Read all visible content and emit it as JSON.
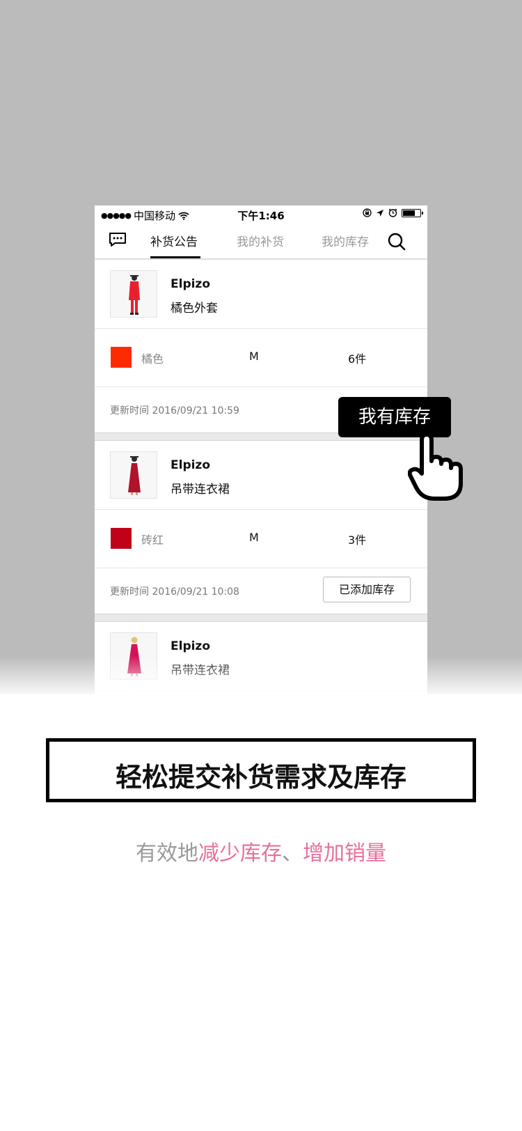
{
  "status_bar": {
    "carrier": "中国移动",
    "time": "下午1:46",
    "battery_level": 0.7
  },
  "nav": {
    "tabs": [
      "补货公告",
      "我的补货",
      "我的库存"
    ],
    "active_tab": 0,
    "icons": [
      "chat-icon",
      "search-icon"
    ]
  },
  "items": [
    {
      "brand": "Elpizo",
      "name": "橘色外套",
      "color_name": "橘色",
      "color_hex": "#ff2b00",
      "size": "M",
      "quantity": "6件",
      "updated": "更新时间 2016/09/21 10:59",
      "garment_color": "#e8202e"
    },
    {
      "brand": "Elpizo",
      "name": "吊带连衣裙",
      "color_name": "砖红",
      "color_hex": "#c00018",
      "size": "M",
      "quantity": "3件",
      "updated": "更新时间 2016/09/21 10:08",
      "action_label": "已添加库存",
      "garment_color": "#b0142a"
    },
    {
      "brand": "Elpizo",
      "name": "吊带连衣裙",
      "garment_color": "#d4145a"
    }
  ],
  "callout": {
    "label": "我有库存"
  },
  "promo": {
    "headline": "轻松提交补货需求及库存",
    "sub_prefix": "有效地",
    "sub_highlight_1": "减少库存",
    "sub_sep": "、",
    "sub_highlight_2": "增加销量",
    "highlight_color": "#e86f9b"
  }
}
